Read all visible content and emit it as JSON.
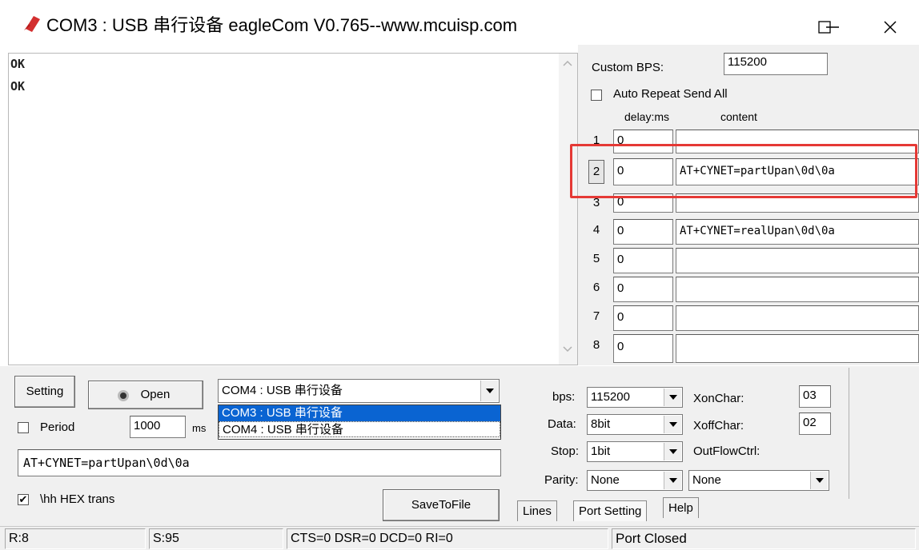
{
  "window": {
    "title": "COM3 : USB 串行设备  eagleCom V0.765--www.mcuisp.com",
    "minimize_glyph": "—",
    "maximize_glyph": "☐",
    "close_glyph": "✕",
    "icon": "app-logo-icon"
  },
  "receive": {
    "lines": [
      "OK",
      "OK"
    ]
  },
  "right_panel": {
    "custom_bps_label": "Custom BPS:",
    "custom_bps_value": "115200",
    "auto_repeat_label": "Auto Repeat Send All",
    "auto_repeat_checked": false,
    "col_delay": "delay:ms",
    "col_content": "content",
    "rows": [
      {
        "num": "1",
        "delay": "0",
        "content": ""
      },
      {
        "num": "2",
        "delay": "0",
        "content": "AT+CYNET=partUpan\\0d\\0a"
      },
      {
        "num": "3",
        "delay": "0",
        "content": ""
      },
      {
        "num": "4",
        "delay": "0",
        "content": "AT+CYNET=realUpan\\0d\\0a"
      },
      {
        "num": "5",
        "delay": "0",
        "content": ""
      },
      {
        "num": "6",
        "delay": "0",
        "content": ""
      },
      {
        "num": "7",
        "delay": "0",
        "content": ""
      },
      {
        "num": "8",
        "delay": "0",
        "content": ""
      }
    ],
    "highlight_color": "#e53935"
  },
  "bottom": {
    "setting_label": "Setting",
    "open_label": "Open",
    "port_selected": "COM4 : USB 串行设备",
    "port_options": [
      "COM3 : USB 串行设备",
      "COM4 : USB 串行设备"
    ],
    "period_label": "Period",
    "period_checked": false,
    "period_value": "1000",
    "period_unit": "ms",
    "send_text": "AT+CYNET=partUpan\\0d\\0a",
    "hex_label": "\\hh HEX trans",
    "hex_checked": true,
    "save_label": "SaveToFile",
    "bps_label": "bps:",
    "bps_value": "115200",
    "data_label": "Data:",
    "data_value": "8bit",
    "stop_label": "Stop:",
    "stop_value": "1bit",
    "parity_label": "Parity:",
    "parity_value": "None",
    "xon_label": "XonChar:",
    "xon_value": "03",
    "xoff_label": "XoffChar:",
    "xoff_value": "02",
    "outflow_label": "OutFlowCtrl:",
    "outflow_value": "None",
    "tabs": [
      "Lines",
      "Port Setting",
      "Help"
    ]
  },
  "status": {
    "r": "R:8",
    "s": "S:95",
    "lines": "CTS=0 DSR=0 DCD=0 RI=0",
    "port": "Port Closed"
  }
}
